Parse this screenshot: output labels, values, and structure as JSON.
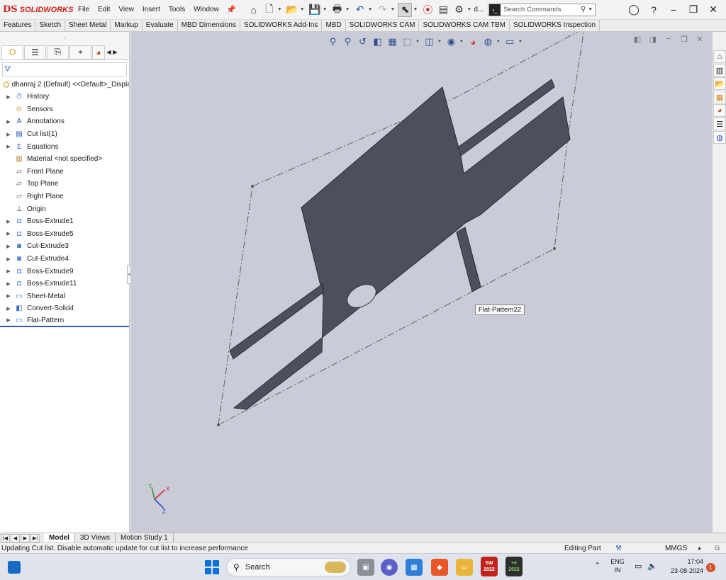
{
  "app": {
    "logo_mark": "DS",
    "logo_text": "SOLIDWORKS"
  },
  "menu": [
    "File",
    "Edit",
    "View",
    "Insert",
    "Tools",
    "Window"
  ],
  "toolbar": {
    "doc_short": "d...",
    "search_placeholder": "Search Commands"
  },
  "command_tabs": [
    "Features",
    "Sketch",
    "Sheet Metal",
    "Markup",
    "Evaluate",
    "MBD Dimensions",
    "SOLIDWORKS Add-Ins",
    "MBD",
    "SOLIDWORKS CAM",
    "SOLIDWORKS CAM TBM",
    "SOLIDWORKS Inspection"
  ],
  "feature_tree": {
    "root": "dhanraj 2 (Default) <<Default>_Displa",
    "items": [
      {
        "label": "History",
        "expandable": true,
        "icon": "history-icon"
      },
      {
        "label": "Sensors",
        "expandable": false,
        "icon": "sensors-icon"
      },
      {
        "label": "Annotations",
        "expandable": true,
        "icon": "annotations-icon"
      },
      {
        "label": "Cut list(1)",
        "expandable": true,
        "icon": "cut-list-icon"
      },
      {
        "label": "Equations",
        "expandable": true,
        "icon": "equations-icon"
      },
      {
        "label": "Material <not specified>",
        "expandable": false,
        "icon": "material-icon"
      },
      {
        "label": "Front Plane",
        "expandable": false,
        "icon": "plane-icon"
      },
      {
        "label": "Top Plane",
        "expandable": false,
        "icon": "plane-icon"
      },
      {
        "label": "Right Plane",
        "expandable": false,
        "icon": "plane-icon"
      },
      {
        "label": "Origin",
        "expandable": false,
        "icon": "origin-icon"
      },
      {
        "label": "Boss-Extrude1",
        "expandable": true,
        "icon": "boss-extrude-icon"
      },
      {
        "label": "Boss-Extrude5",
        "expandable": true,
        "icon": "boss-extrude-icon"
      },
      {
        "label": "Cut-Extrude3",
        "expandable": true,
        "icon": "cut-extrude-icon"
      },
      {
        "label": "Cut-Extrude4",
        "expandable": true,
        "icon": "cut-extrude-icon"
      },
      {
        "label": "Boss-Extrude9",
        "expandable": true,
        "icon": "boss-extrude-icon"
      },
      {
        "label": "Boss-Extrude11",
        "expandable": true,
        "icon": "boss-extrude-icon"
      },
      {
        "label": "Sheet-Metal",
        "expandable": true,
        "icon": "sheet-metal-icon"
      },
      {
        "label": "Convert-Solid4",
        "expandable": true,
        "icon": "convert-solid-icon"
      },
      {
        "label": "Flat-Pattern",
        "expandable": true,
        "icon": "flat-pattern-icon"
      }
    ]
  },
  "viewport": {
    "tooltip": "Flat-Pattern22",
    "background": "#c9cbd7",
    "part_color": "#4d505c"
  },
  "bottom_tabs": [
    "Model",
    "3D Views",
    "Motion Study 1"
  ],
  "status": {
    "message": "Updating Cut list. Disable automatic update for cut list to increase performance",
    "mode": "Editing Part",
    "units": "MMGS"
  },
  "taskbar": {
    "search_label": "Search",
    "lang_line1": "ENG",
    "lang_line2": "IN",
    "time": "17:04",
    "date": "23-08-2024",
    "notifications": "1",
    "sw_badge": "2022",
    "ie_badge": "2022"
  }
}
